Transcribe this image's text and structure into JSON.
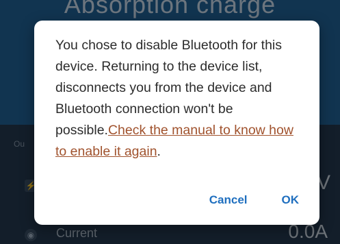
{
  "background": {
    "charge_state": "Absorption charge",
    "output_label": "Ou",
    "voltage_value": "V",
    "current_label": "Current",
    "current_value": "0.0A"
  },
  "dialog": {
    "message": "You chose to disable Bluetooth for this device. Returning to the device list, disconnects you from the device and Bluetooth connection won't be possible.",
    "link_text": "Check the manual to know how to enable it again",
    "trailing": ".",
    "cancel_label": "Cancel",
    "ok_label": "OK"
  },
  "colors": {
    "link": "#a0522d",
    "button_accent": "#1f6fbf",
    "header_blue": "#1f5f93"
  },
  "icons": [
    "bolt-icon",
    "current-icon"
  ]
}
